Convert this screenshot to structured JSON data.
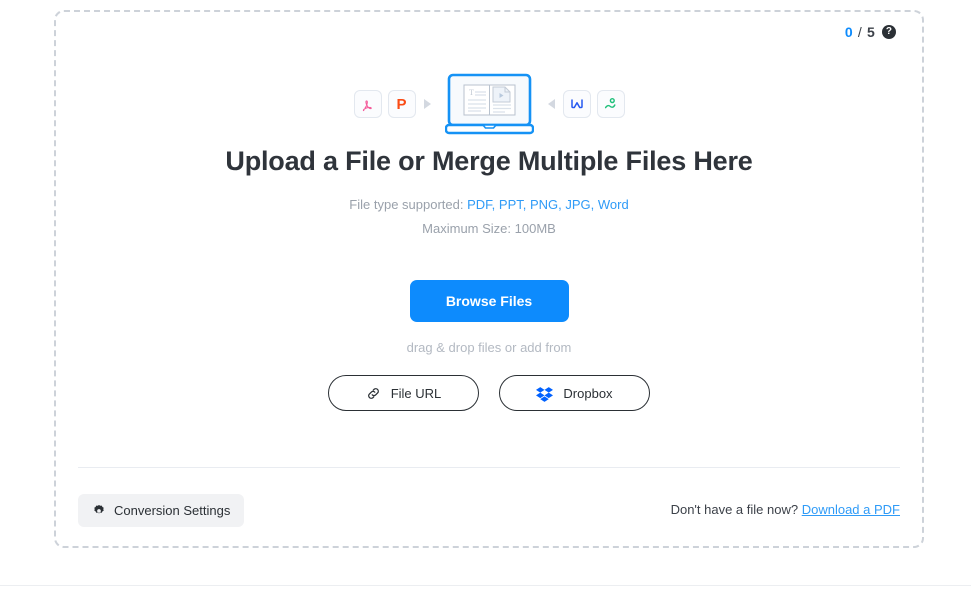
{
  "counter": {
    "current": "0",
    "separator": "/",
    "max": "5",
    "help_icon": "question-mark-circle-icon",
    "current_color": "#0d8bfd"
  },
  "hero": {
    "title": "Upload a File or Merge Multiple Files Here",
    "support_prefix": "File type supported:",
    "support_types": "PDF, PPT, PNG, JPG, Word",
    "max_size": "Maximum Size: 100MB",
    "icons": {
      "left": [
        "pdf-file-icon",
        "powerpoint-file-icon"
      ],
      "center": "laptop-document-preview-icon",
      "right": [
        "word-file-icon",
        "image-file-icon"
      ],
      "arrow_left": "arrow-right-triangle-icon",
      "arrow_right": "arrow-left-triangle-icon"
    }
  },
  "actions": {
    "browse_label": "Browse Files",
    "browse_color": "#0d8bfd",
    "drag_drop_text": "drag & drop files or add from",
    "sources": [
      {
        "label": "File URL",
        "icon": "link-chain-icon"
      },
      {
        "label": "Dropbox",
        "icon": "dropbox-icon"
      }
    ]
  },
  "footer": {
    "settings_label": "Conversion Settings",
    "settings_icon": "gear-icon",
    "prompt_text": "Don't have a file now?",
    "download_link": "Download a PDF",
    "link_color": "#2f9bf7"
  }
}
